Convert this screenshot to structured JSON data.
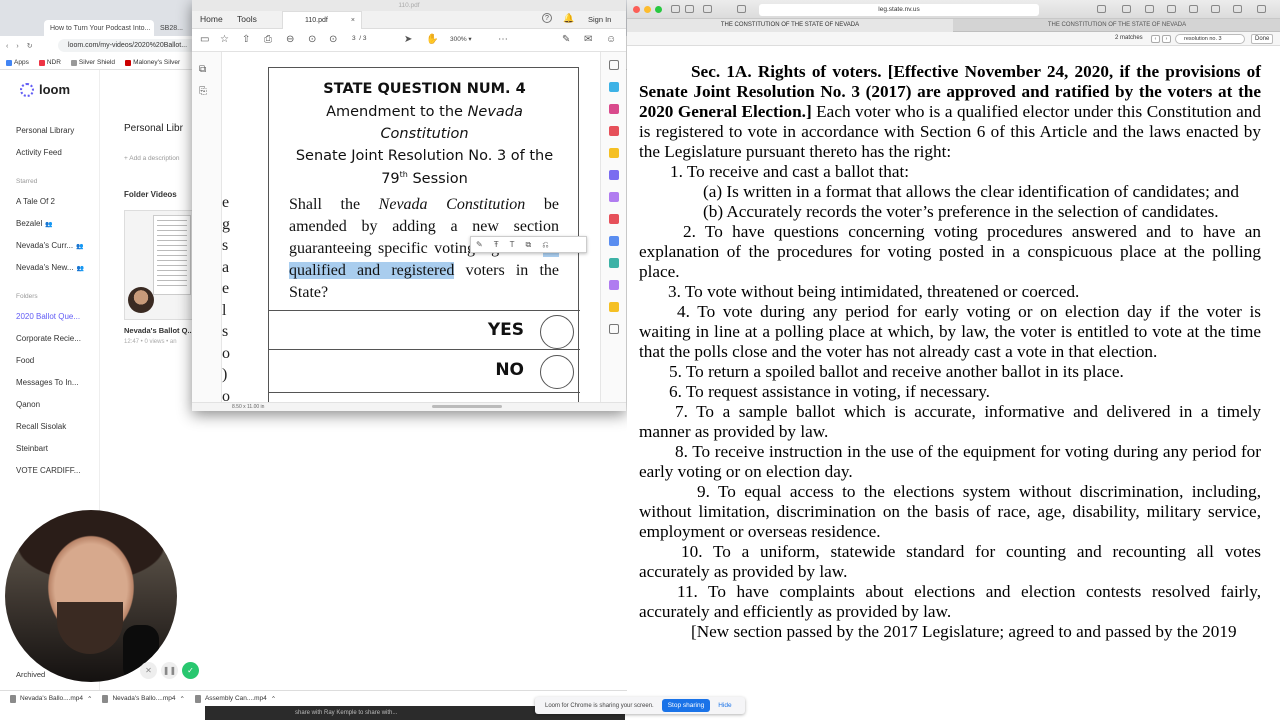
{
  "bg_chrome": {
    "tabs": [
      "How to Turn Your Podcast Into...",
      "SB28..."
    ],
    "url": "loom.com/my-videos/2020%20Ballot...",
    "bookmarks": [
      "Apps",
      "NDR",
      "Silver Shield",
      "Maloney's Silver"
    ]
  },
  "loom": {
    "logo": "loom",
    "nav": [
      "Personal Library",
      "Activity Feed"
    ],
    "starred_heading": "Starred",
    "starred": [
      "A Tale Of 2",
      "Bezalel",
      "Nevada's Curr...",
      "Nevada's New..."
    ],
    "folders_heading": "Folders",
    "folders": [
      "2020 Ballot Que...",
      "Corporate Recie...",
      "Food",
      "Messages To In...",
      "Qanon",
      "Recall Sisolak",
      "Steinbart",
      "VOTE CARDIFF..."
    ],
    "archived": "Archived",
    "main_title": "Personal Libr",
    "add_description": "+ Add a description",
    "folder_videos": "Folder Videos",
    "video_title": "Nevada's Ballot Q...",
    "video_meta": "12:47 • 0 views • an"
  },
  "downloads": [
    "Nevada's Ballo....mp4",
    "Nevada's Ballo....mp4",
    "Assembly Can....mp4"
  ],
  "share_bar": {
    "text": "Loom for Chrome is sharing your screen.",
    "stop": "Stop sharing",
    "hide": "Hide"
  },
  "under_strip": [
    "share with Ray Kemple to share with..."
  ],
  "pdf": {
    "window_title": "110.pdf",
    "tabs": [
      "Home",
      "Tools"
    ],
    "file_tab": "110.pdf",
    "sign_in": "Sign In",
    "page_current": "3",
    "page_total": "/ 3",
    "zoom": "300%",
    "page_size": "8.50 x 11.00 in",
    "left_col": [
      "e",
      "g",
      "s",
      "a",
      "e",
      "l",
      "s",
      "o",
      ")",
      "o"
    ],
    "title": "STATE QUESTION NUM. 4",
    "line1_pre": "Amendment to the ",
    "line1_em": "Nevada",
    "line2_em": "Constitution",
    "line3": "Senate Joint Resolution No. 3 of the",
    "line4_pre": "79",
    "line4_sup": "th",
    "line4_post": " Session",
    "body_a": "Shall the ",
    "body_em": "Nevada Constitution",
    "body_b": " be amended by adding a new section guaranteeing specific voting rights to ",
    "body_hl": "all qualified and registered",
    "body_c": " voters in the State?",
    "yes": "YES",
    "no": "NO"
  },
  "safari": {
    "url": "leg.state.nv.us",
    "tabs": [
      "THE CONSTITUTION OF THE STATE OF NEVADA",
      "THE CONSTITUTION OF THE STATE OF NEVADA"
    ],
    "find_count": "2 matches",
    "find_query": "resolution no. 3",
    "find_done": "Done"
  },
  "law": {
    "heading": "Sec. 1A.   Rights of voters. [Effective November 24, 2020, if the provisions of Senate Joint Resolution No. 3 (2017) are approved and ratified by the voters at the 2020 General Election.]",
    "intro": "   Each voter who is a qualified elector under this Constitution and is registered to vote in accordance with Section 6 of this Article and the laws enacted by the Legislature pursuant thereto has the right:",
    "items": [
      "1.   To receive and cast a ballot that:",
      "(a) Is written in a format that allows the clear identification of candidates; and",
      "(b) Accurately records the voter’s preference in the selection of candidates.",
      "2.   To have questions concerning voting procedures answered and to have an explanation of the procedures for voting posted in a conspicuous place at the polling place.",
      "3.   To vote without being intimidated, threatened or coerced.",
      "4.   To vote during any period for early voting or on election day if the voter is waiting in line at a polling place at which, by law, the voter is entitled to vote at the time that the polls close and the voter has not already cast a vote in that election.",
      "5.   To return a spoiled ballot and receive another ballot in its place.",
      "6.   To request assistance in voting, if necessary.",
      "7.   To a sample ballot which is accurate, informative and delivered in a timely manner as provided by law.",
      "8.   To receive instruction in the use of the equipment for voting during any period for early voting or on election day.",
      "9.   To equal access to the elections system without discrimination, including, without limitation, discrimination on the basis of race, age, disability, military service, employment or overseas residence.",
      "10.   To a uniform, statewide standard for counting and recounting all votes accurately as provided by law.",
      "11.   To have complaints about elections and election contests resolved fairly, accurately and efficiently as provided by law."
    ],
    "footer": "[New section passed by the 2017 Legislature; agreed to and passed by the 2019"
  }
}
